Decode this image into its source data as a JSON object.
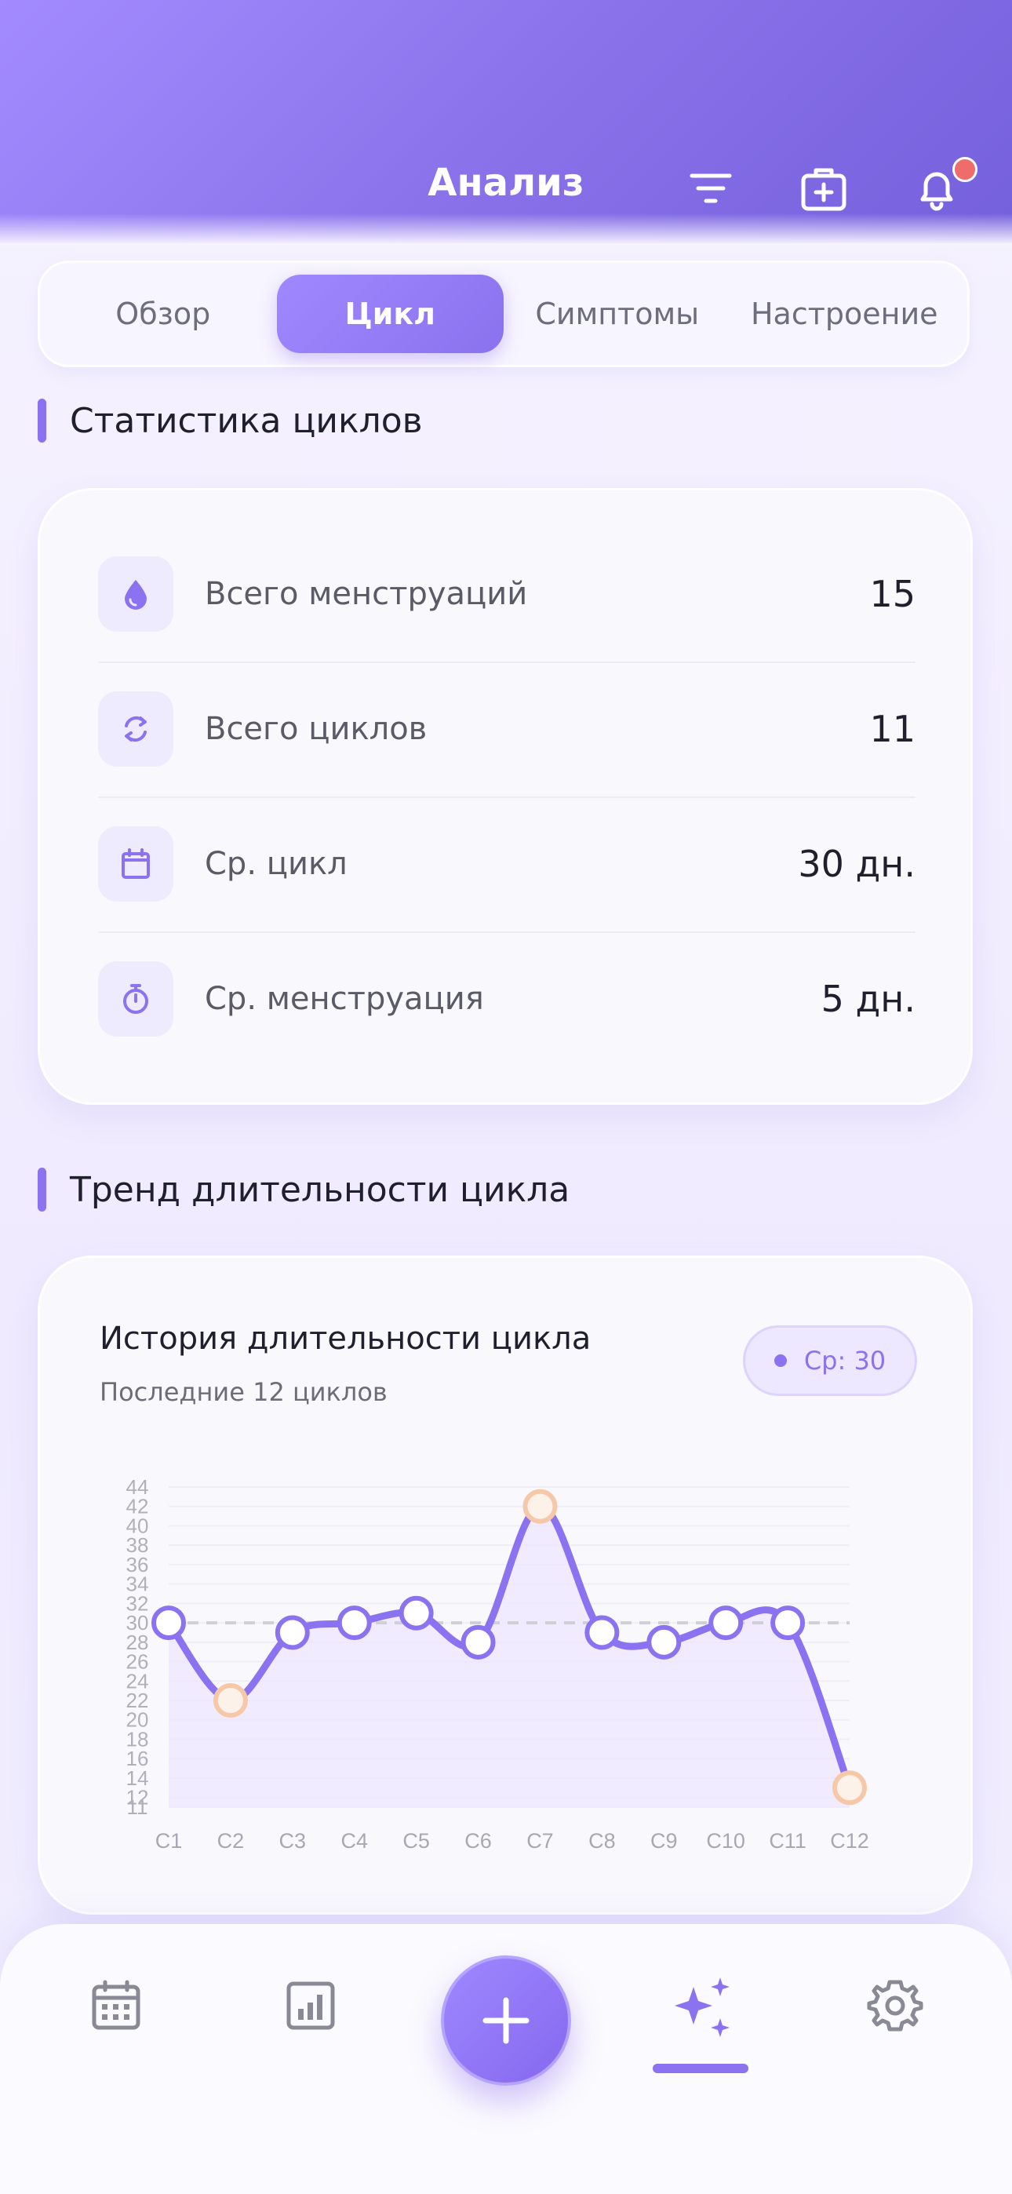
{
  "header": {
    "title": "Анализ",
    "icons": [
      "filter-icon",
      "medical-kit-icon",
      "bell-icon"
    ]
  },
  "tabs": [
    {
      "label": "Обзор",
      "active": false
    },
    {
      "label": "Цикл",
      "active": true
    },
    {
      "label": "Симптомы",
      "active": false
    },
    {
      "label": "Настроение",
      "active": false
    }
  ],
  "stats_section": {
    "title": "Статистика циклов",
    "rows": [
      {
        "icon": "drop-icon",
        "label": "Всего менструаций",
        "value": "15"
      },
      {
        "icon": "cycle-icon",
        "label": "Всего циклов",
        "value": "11"
      },
      {
        "icon": "calendar-icon",
        "label": "Ср. цикл",
        "value": "30 дн."
      },
      {
        "icon": "timer-icon",
        "label": "Ср. менструация",
        "value": "5 дн."
      }
    ]
  },
  "trend_section": {
    "title": "Тренд длительности цикла",
    "card_title": "История длительности цикла",
    "card_subtitle": "Последние 12 циклов",
    "avg_label": "Ср: 30"
  },
  "chart_data": {
    "type": "line",
    "title": "История длительности цикла",
    "subtitle": "Последние 12 циклов",
    "categories": [
      "C1",
      "C2",
      "C3",
      "C4",
      "C5",
      "C6",
      "C7",
      "C8",
      "C9",
      "C10",
      "C11",
      "C12"
    ],
    "values": [
      30,
      22,
      29,
      30,
      31,
      28,
      42,
      29,
      28,
      30,
      30,
      13
    ],
    "outliers": [
      false,
      true,
      false,
      false,
      false,
      false,
      true,
      false,
      false,
      false,
      false,
      true
    ],
    "yticks": [
      11,
      12,
      14,
      16,
      18,
      20,
      22,
      24,
      26,
      28,
      30,
      32,
      34,
      36,
      38,
      40,
      42,
      44
    ],
    "ylim": [
      11,
      44
    ],
    "average": 30,
    "xlabel": "",
    "ylabel": "",
    "grid": true,
    "colors": {
      "line": "#8b72f0",
      "outlier": "#f6c8a8",
      "area": "#ece6ff",
      "average_line": "#cfcfd6"
    }
  },
  "bottom_nav": {
    "items": [
      "calendar-icon",
      "stats-icon",
      "add-icon",
      "sparkles-icon",
      "settings-icon"
    ],
    "active": "sparkles-icon"
  },
  "colors": {
    "accent": "#8b72f0",
    "badge": "#f06b6b"
  }
}
